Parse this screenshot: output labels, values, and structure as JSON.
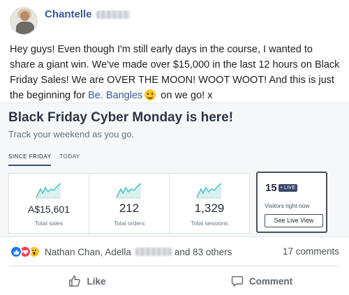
{
  "post": {
    "author_name": "Chantelle",
    "text_lines": [
      "Hey guys! Even though I'm still early days in the course, I wanted to",
      "share a giant win. We've made over $15,000 in the last 12 hours on Black",
      "Friday Sales! We are OVER THE MOON! WOOT WOOT! And this is just"
    ],
    "text_line4_before": "the beginning for ",
    "text_line4_link": "Be. Bangles",
    "text_line4_after": " on we go! x"
  },
  "card": {
    "title": "Black Friday Cyber Monday is here!",
    "subtitle": "Track your weekend as you go.",
    "tabs": [
      "SINCE FRIDAY",
      "TODAY"
    ],
    "active_tab": "SINCE FRIDAY",
    "stats": [
      {
        "value": "A$15,601",
        "label": "Total sales"
      },
      {
        "value": "212",
        "label": "Total orders"
      },
      {
        "value": "1,329",
        "label": "Total sessions"
      }
    ],
    "live": {
      "count": "15",
      "badge": "• LIVE",
      "label": "Visitors right now",
      "button": "See Live View"
    },
    "accent_color": "#47c1bf"
  },
  "reactions": {
    "icons": [
      "like-reaction-icon",
      "love-reaction-icon",
      "wow-reaction-icon"
    ],
    "names_start": "Nathan Chan, Adella",
    "names_end": "and 83 others",
    "comments": "17 comments"
  },
  "actions": {
    "like_label": "Like",
    "comment_label": "Comment"
  }
}
